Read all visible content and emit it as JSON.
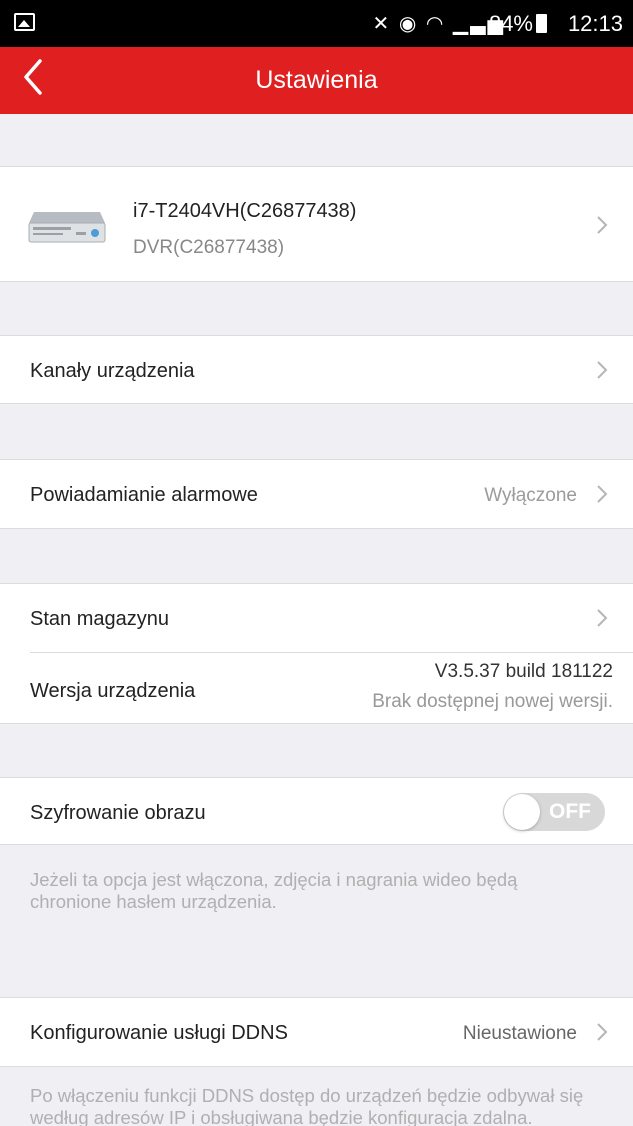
{
  "status_bar": {
    "battery": "84%",
    "time": "12:13"
  },
  "header": {
    "title": "Ustawienia"
  },
  "device": {
    "name": "i7-T2404VH(C26877438)",
    "type": "DVR(C26877438)"
  },
  "rows": {
    "channels": {
      "label": "Kanały urządzenia"
    },
    "alarm": {
      "label": "Powiadamianie alarmowe",
      "value": "Wyłączone"
    },
    "storage": {
      "label": "Stan magazynu"
    },
    "version": {
      "label": "Wersja urządzenia",
      "value": "V3.5.37 build 181122",
      "note": "Brak dostępnej nowej wersji."
    },
    "encryption": {
      "label": "Szyfrowanie obrazu",
      "toggle": "OFF",
      "note": "Jeżeli ta opcja jest włączona, zdjęcia i nagrania wideo będą chronione hasłem urządzenia."
    },
    "ddns": {
      "label": "Konfigurowanie usługi DDNS",
      "value": "Nieustawione",
      "note": "Po włączeniu funkcji DDNS dostęp do urządzeń będzie odbywał się według adresów IP i obsługiwana będzie konfiguracja zdalna."
    }
  },
  "colors": {
    "accent": "#e02020",
    "background": "#efeff4"
  }
}
